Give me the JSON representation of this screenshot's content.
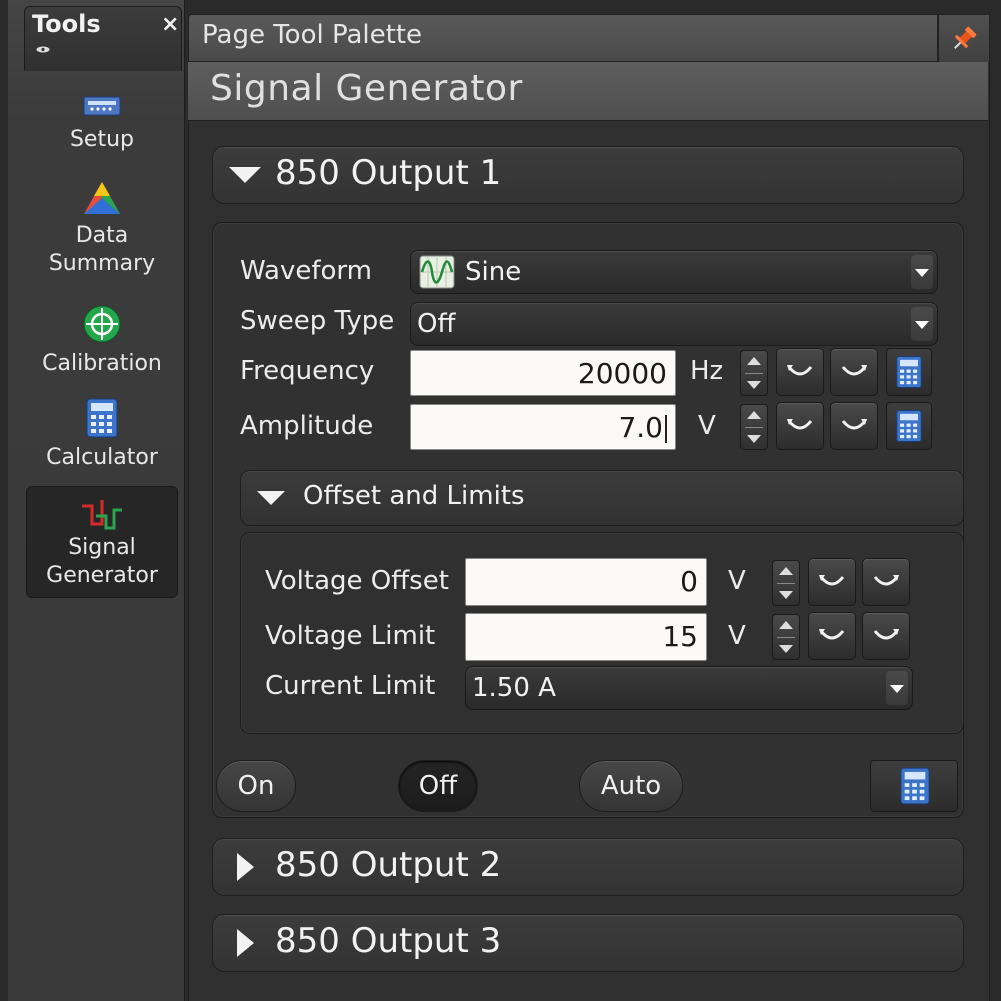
{
  "tools": {
    "title": "Tools",
    "close": "×",
    "items": [
      {
        "label": "Setup",
        "icon": "setup-icon"
      },
      {
        "label": "Data Summary",
        "icon": "data-summary-icon"
      },
      {
        "label": "Calibration",
        "icon": "calibration-icon"
      },
      {
        "label": "Calculator",
        "icon": "calculator-icon"
      },
      {
        "label": "Signal Generator",
        "icon": "signal-generator-icon",
        "active": true
      }
    ]
  },
  "palette": {
    "title": "Page Tool Palette",
    "pin_icon": "pin-icon"
  },
  "signal_generator": {
    "title": "Signal Generator",
    "output1": {
      "label": "850 Output 1",
      "waveform": {
        "label": "Waveform",
        "value": "Sine",
        "icon": "sine-wave-icon"
      },
      "sweep_type": {
        "label": "Sweep Type",
        "value": "Off"
      },
      "frequency": {
        "label": "Frequency",
        "value": "20000",
        "unit": "Hz"
      },
      "amplitude": {
        "label": "Amplitude",
        "value": "7.0",
        "unit": "V"
      },
      "offset_limits": {
        "label": "Offset and Limits",
        "voltage_offset": {
          "label": "Voltage Offset",
          "value": "0",
          "unit": "V"
        },
        "voltage_limit": {
          "label": "Voltage Limit",
          "value": "15",
          "unit": "V"
        },
        "current_limit": {
          "label": "Current Limit",
          "value": "1.50 A"
        }
      },
      "buttons": {
        "on": "On",
        "off": "Off",
        "auto": "Auto",
        "selected": "off"
      }
    },
    "output2": {
      "label": "850 Output 2"
    },
    "output3": {
      "label": "850 Output 3"
    }
  },
  "colors": {
    "panel_bg": "#303030",
    "input_bg": "#fcfaf6",
    "pin": "#e8531b"
  }
}
